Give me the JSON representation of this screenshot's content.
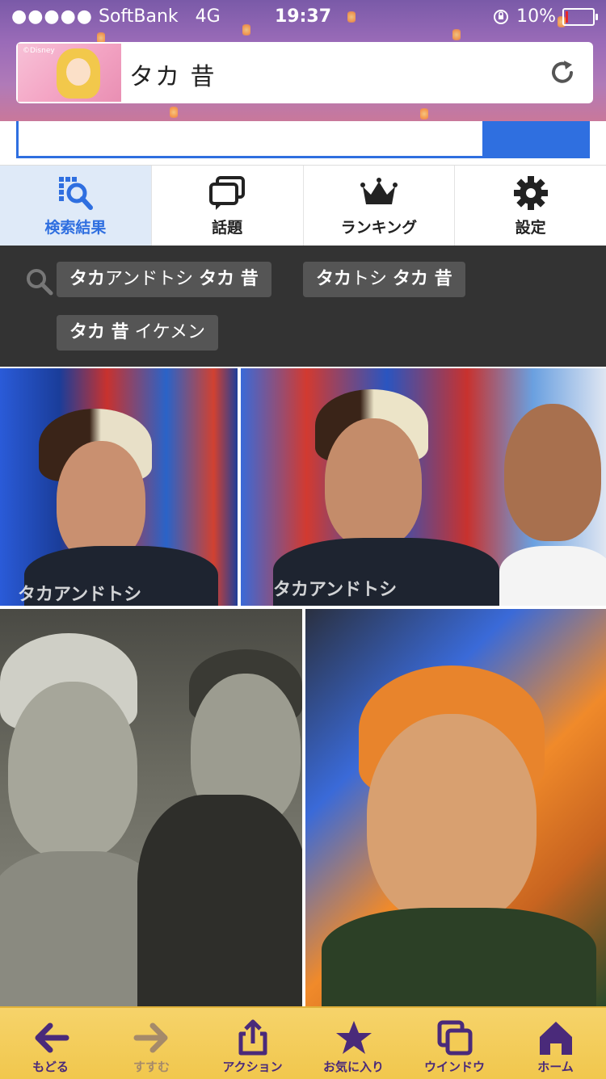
{
  "status_bar": {
    "signal_dots": "●●●●●",
    "carrier": "SoftBank",
    "network": "4G",
    "time": "19:37",
    "battery_percent": "10%",
    "battery_level": 0.1
  },
  "browser": {
    "thumbnail_credit": "©Disney",
    "url_text": "タカ 昔"
  },
  "tabs": [
    {
      "label": "検索結果",
      "icon": "search-results-icon",
      "active": true
    },
    {
      "label": "話題",
      "icon": "chat-bubbles-icon",
      "active": false
    },
    {
      "label": "ランキング",
      "icon": "crown-icon",
      "active": false
    },
    {
      "label": "設定",
      "icon": "gear-icon",
      "active": false
    }
  ],
  "related_searches": [
    {
      "bold1": "タカ",
      "mid": "アンドトシ ",
      "bold2": "タカ 昔"
    },
    {
      "bold1": "タカ",
      "mid": "トシ ",
      "bold2": "タカ 昔"
    },
    {
      "bold1": "タカ 昔",
      "mid": " イケメン",
      "bold2": ""
    }
  ],
  "images": [
    {
      "caption": "タカアンドトシ"
    },
    {
      "caption": "タカアンドトシ"
    },
    {
      "caption": ""
    },
    {
      "caption": ""
    }
  ],
  "toolbar": [
    {
      "label": "もどる",
      "icon": "back-arrow-icon",
      "enabled": true
    },
    {
      "label": "すすむ",
      "icon": "forward-arrow-icon",
      "enabled": false
    },
    {
      "label": "アクション",
      "icon": "share-icon",
      "enabled": true
    },
    {
      "label": "お気に入り",
      "icon": "star-icon",
      "enabled": true
    },
    {
      "label": "ウインドウ",
      "icon": "windows-icon",
      "enabled": true
    },
    {
      "label": "ホーム",
      "icon": "home-icon",
      "enabled": true
    }
  ],
  "colors": {
    "accent_blue": "#2f6fe0",
    "toolbar_yellow": "#f1c74d",
    "toolbar_icon": "#4a2a7a",
    "related_bg": "#333333"
  }
}
